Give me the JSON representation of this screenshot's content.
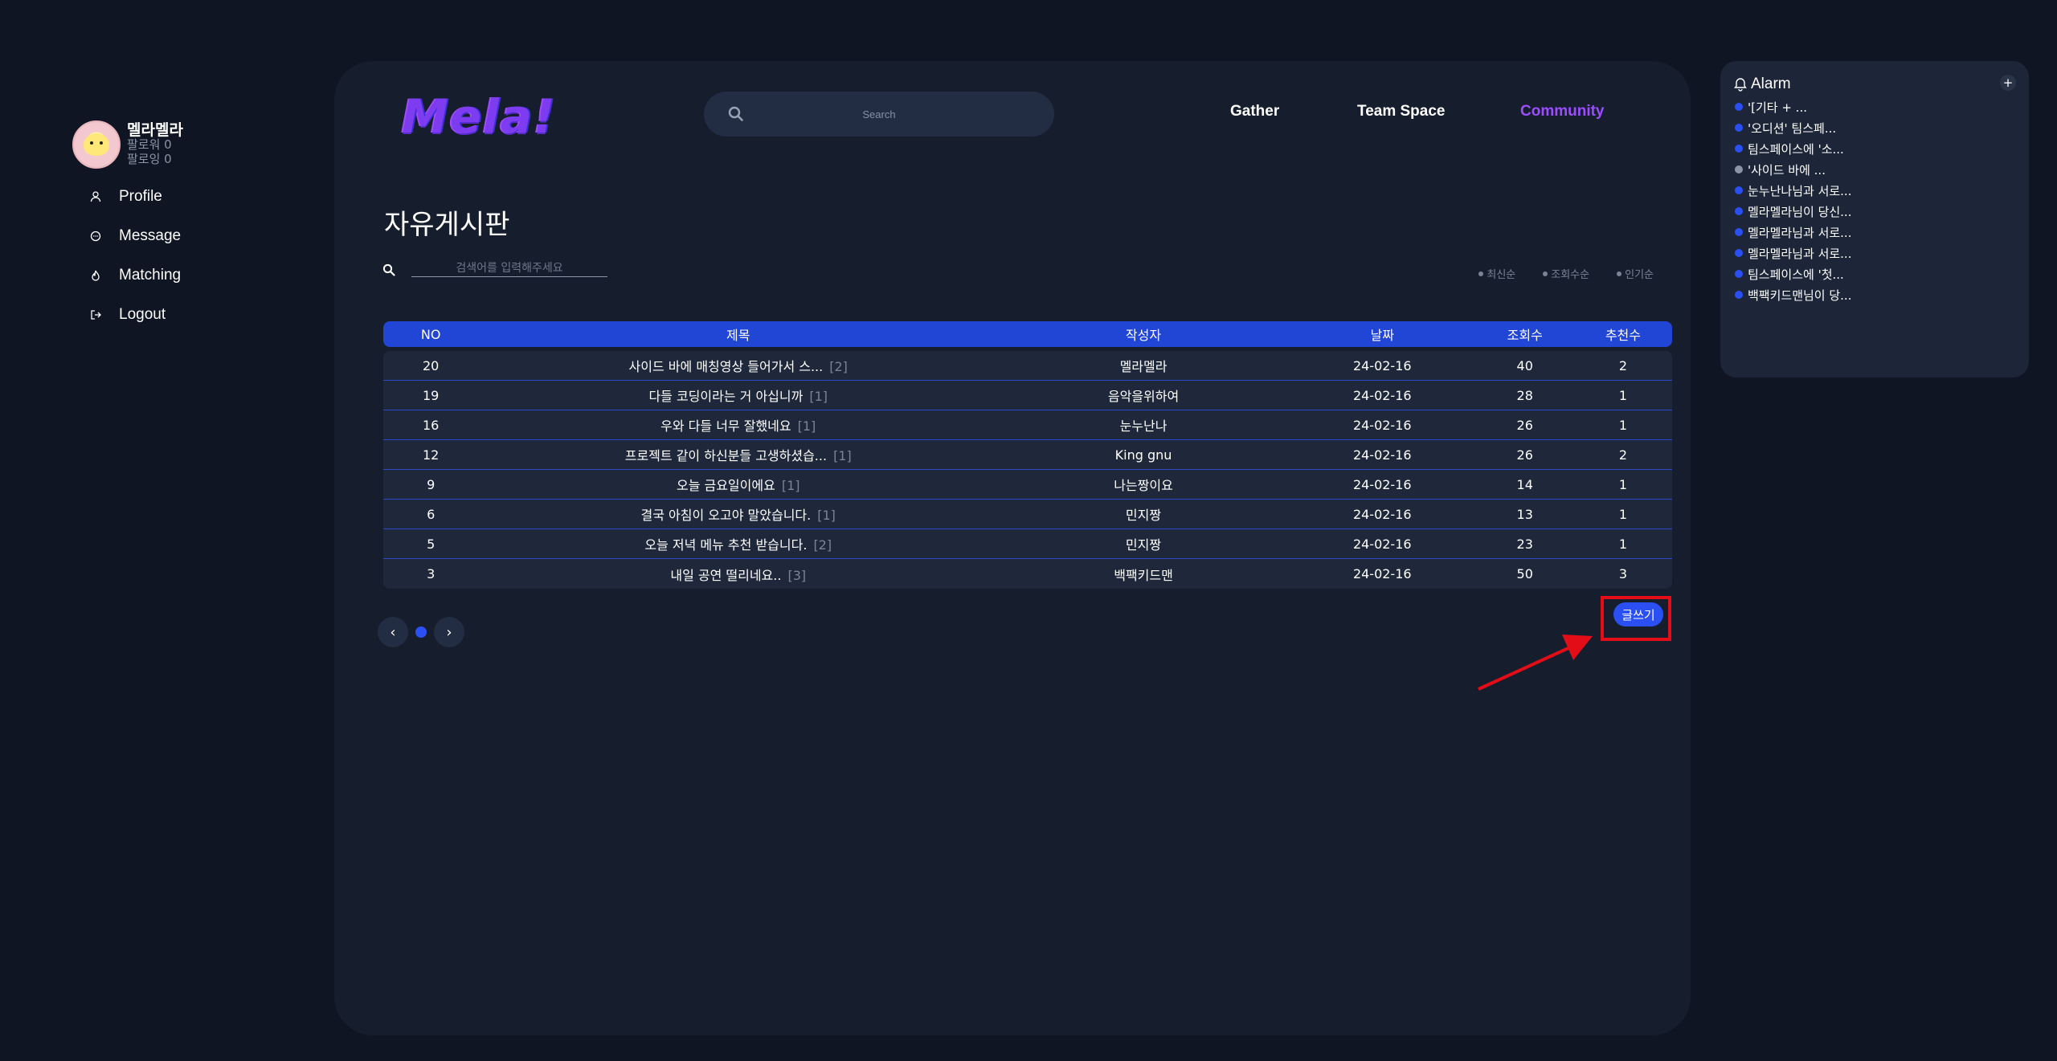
{
  "profile": {
    "name": "멜라멜라",
    "followers": "팔로워 0",
    "following": "팔로잉 0"
  },
  "sidebar": {
    "items": [
      {
        "label": "Profile",
        "icon": "user-icon"
      },
      {
        "label": "Message",
        "icon": "chat-icon"
      },
      {
        "label": "Matching",
        "icon": "flame-icon"
      },
      {
        "label": "Logout",
        "icon": "logout-icon"
      }
    ]
  },
  "header": {
    "logo": "Mela!",
    "search_placeholder": "Search",
    "nav": [
      "Gather",
      "Team Space",
      "Community"
    ],
    "active_nav": "Community"
  },
  "board": {
    "title": "자유게시판",
    "search_placeholder": "검색어를 입력해주세요",
    "sort_options": [
      "최신순",
      "조회수순",
      "인기순"
    ],
    "columns": [
      "NO",
      "제목",
      "작성자",
      "날짜",
      "조회수",
      "추천수"
    ],
    "rows": [
      {
        "no": "20",
        "title": "사이드 바에 매칭영상 들어가서 스...",
        "comments": "[2]",
        "author": "멜라멜라",
        "date": "24-02-16",
        "views": "40",
        "recs": "2"
      },
      {
        "no": "19",
        "title": "다들 코딩이라는 거 아십니까",
        "comments": "[1]",
        "author": "음악을위하여",
        "date": "24-02-16",
        "views": "28",
        "recs": "1"
      },
      {
        "no": "16",
        "title": "우와 다들 너무 잘했네요",
        "comments": "[1]",
        "author": "눈누난나",
        "date": "24-02-16",
        "views": "26",
        "recs": "1"
      },
      {
        "no": "12",
        "title": "프로젝트 같이 하신분들 고생하셨습...",
        "comments": "[1]",
        "author": "King gnu",
        "date": "24-02-16",
        "views": "26",
        "recs": "2"
      },
      {
        "no": "9",
        "title": "오늘 금요일이에요",
        "comments": "[1]",
        "author": "나는짱이요",
        "date": "24-02-16",
        "views": "14",
        "recs": "1"
      },
      {
        "no": "6",
        "title": "결국 아침이 오고야 말았습니다.",
        "comments": "[1]",
        "author": "민지짱",
        "date": "24-02-16",
        "views": "13",
        "recs": "1"
      },
      {
        "no": "5",
        "title": "오늘 저녁 메뉴 추천 받습니다.",
        "comments": "[2]",
        "author": "민지짱",
        "date": "24-02-16",
        "views": "23",
        "recs": "1"
      },
      {
        "no": "3",
        "title": "내일 공연 떨리네요..",
        "comments": "[3]",
        "author": "백팩키드맨",
        "date": "24-02-16",
        "views": "50",
        "recs": "3"
      }
    ],
    "write_label": "글쓰기",
    "pager": {
      "prev": "‹",
      "next": "›"
    }
  },
  "alarm": {
    "title": "Alarm",
    "add_label": "+",
    "items": [
      {
        "text": "'[기타 + ...",
        "read": false
      },
      {
        "text": "'오디션' 팀스페...",
        "read": false
      },
      {
        "text": "팀스페이스에 '소...",
        "read": false
      },
      {
        "text": "'사이드 바에 ...",
        "read": true
      },
      {
        "text": "눈누난나님과 서로...",
        "read": false
      },
      {
        "text": "멜라멜라님이 당신...",
        "read": false
      },
      {
        "text": "멜라멜라님과 서로...",
        "read": false
      },
      {
        "text": "멜라멜라님과 서로...",
        "read": false
      },
      {
        "text": "팀스페이스에 '첫...",
        "read": false
      },
      {
        "text": "백팩키드맨님이 당...",
        "read": false
      }
    ]
  },
  "colors": {
    "accent": "#2a4ff2",
    "active_nav": "#9b4dff",
    "highlight": "#e30d17"
  }
}
